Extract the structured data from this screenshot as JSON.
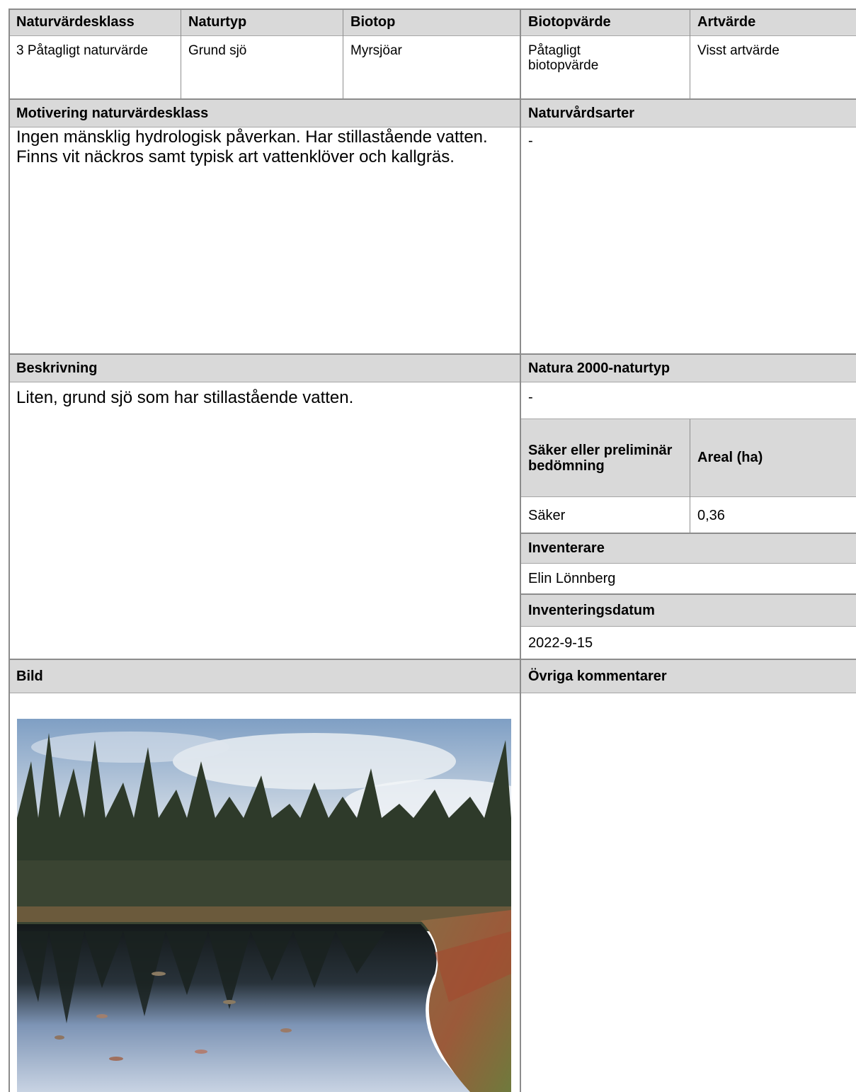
{
  "top_row": {
    "headers": [
      "Naturvärdesklass",
      "Naturtyp",
      "Biotop",
      "Biotopvärde",
      "Artvärde"
    ],
    "values": {
      "naturvardesklass": "3 Påtagligt naturvärde",
      "naturtyp": "Grund sjö",
      "biotop": "Myrsjöar",
      "biotopvarde": "Påtagligt biotopvärde",
      "artvarde": "Visst artvärde"
    }
  },
  "motivering": {
    "header": "Motivering naturvärdesklass",
    "text": "Ingen mänsklig hydrologisk påverkan. Har stillastående vatten. Finns vit näckros samt typisk art vattenklöver och kallgräs."
  },
  "naturvardsarter": {
    "header": "Naturvårdsarter",
    "value": "-"
  },
  "beskrivning": {
    "header": "Beskrivning",
    "text": "Liten, grund sjö som har stillastående vatten."
  },
  "natura2000": {
    "header": "Natura 2000-naturtyp",
    "value": "-"
  },
  "bedomning": {
    "header_left": "Säker eller preliminär bedömning",
    "header_right": "Areal (ha)",
    "value_left": "Säker",
    "value_right": "0,36"
  },
  "inventerare": {
    "header": "Inventerare",
    "value": "Elin Lönnberg"
  },
  "inventeringsdatum": {
    "header": "Inventeringsdatum",
    "value": "2022-9-15"
  },
  "bild": {
    "header": "Bild"
  },
  "ovriga": {
    "header": "Övriga kommentarer"
  },
  "colors": {
    "header_bg": "#d9d9d9",
    "border": "#8c8c8c"
  }
}
